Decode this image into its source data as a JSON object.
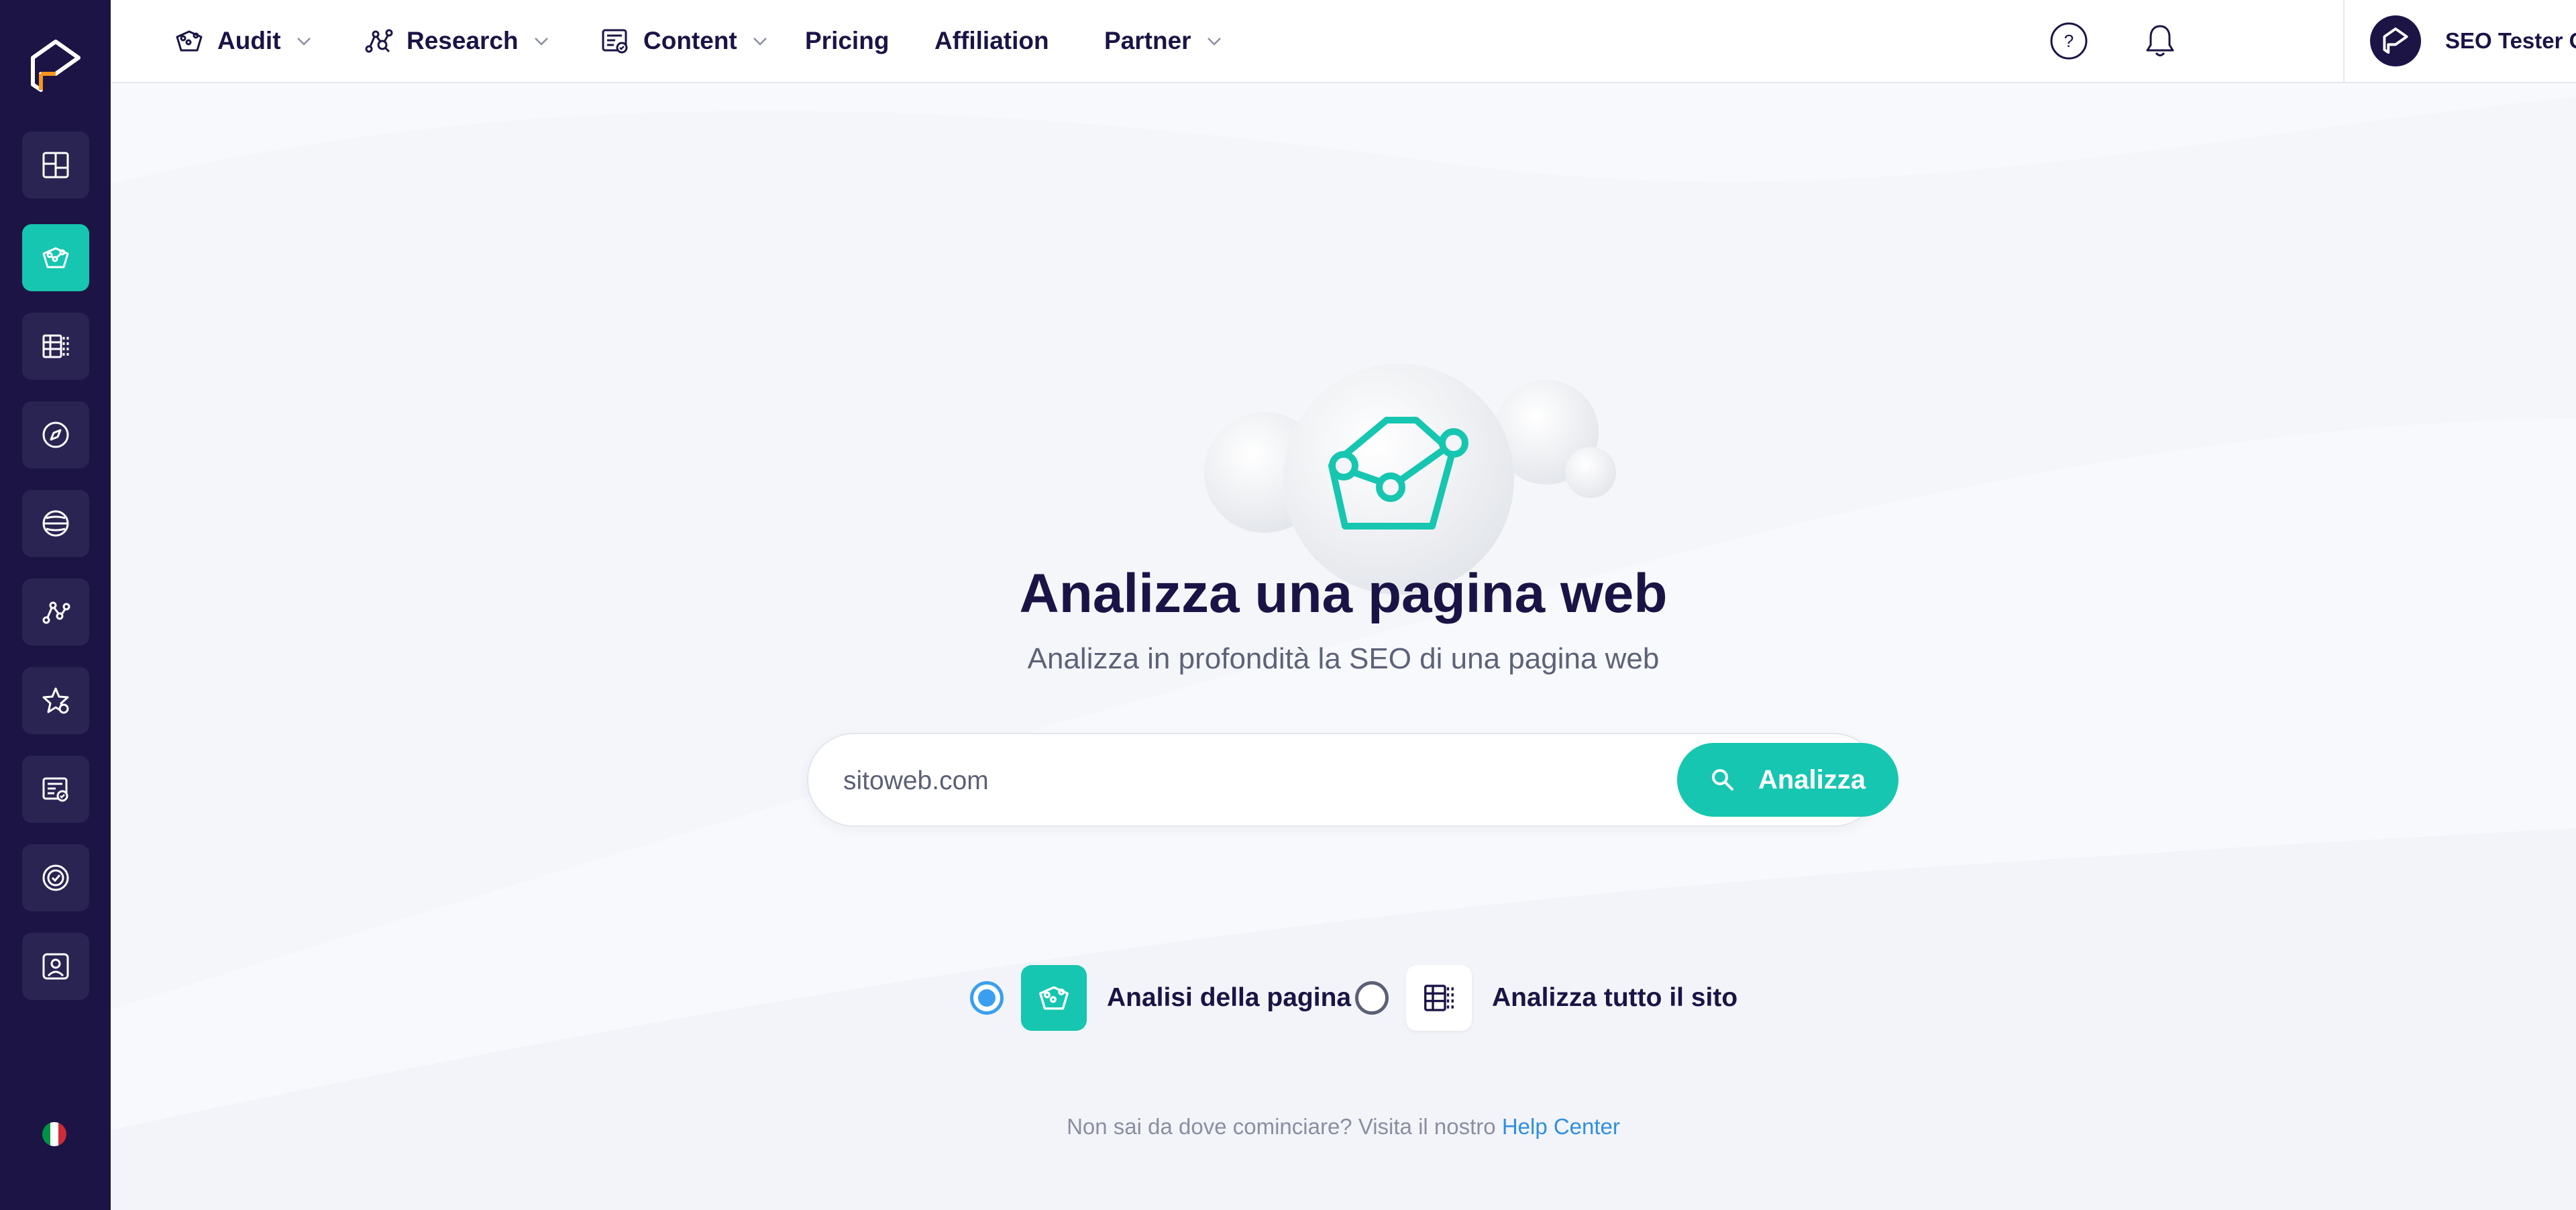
{
  "colors": {
    "sidebar_bg": "#1c1445",
    "accent": "#16c6b0",
    "text_dark": "#1a1446",
    "link": "#2f8fe0",
    "radio_selected": "#3a9ff0"
  },
  "sidebar": {
    "items": [
      {
        "icon": "dashboard-icon",
        "active": false
      },
      {
        "icon": "audit-basket-icon",
        "active": true
      },
      {
        "icon": "site-table-icon",
        "active": false
      },
      {
        "icon": "compass-icon",
        "active": false
      },
      {
        "icon": "globe-icon",
        "active": false
      },
      {
        "icon": "graph-nodes-icon",
        "active": false
      },
      {
        "icon": "star-badge-icon",
        "active": false
      },
      {
        "icon": "content-check-icon",
        "active": false
      },
      {
        "icon": "target-check-icon",
        "active": false
      },
      {
        "icon": "profile-frame-icon",
        "active": false
      }
    ],
    "language_flag": "italy-flag-icon"
  },
  "topnav": {
    "audit": "Audit",
    "research": "Research",
    "content": "Content",
    "pricing": "Pricing",
    "affiliation": "Affiliation",
    "partner": "Partner"
  },
  "user": {
    "name": "SEO Tester Online"
  },
  "hero": {
    "title": "Analizza una pagina web",
    "subtitle": "Analizza in profondità la SEO di una pagina web"
  },
  "search": {
    "placeholder": "sitoweb.com",
    "button_label": "Analizza"
  },
  "modes": [
    {
      "label": "Analisi della pagina",
      "selected": true,
      "icon": "audit-basket-icon"
    },
    {
      "label": "Analizza tutto il sito",
      "selected": false,
      "icon": "site-table-icon"
    }
  ],
  "help": {
    "text": "Non sai da dove cominciare? Visita il nostro",
    "link": "Help Center"
  }
}
